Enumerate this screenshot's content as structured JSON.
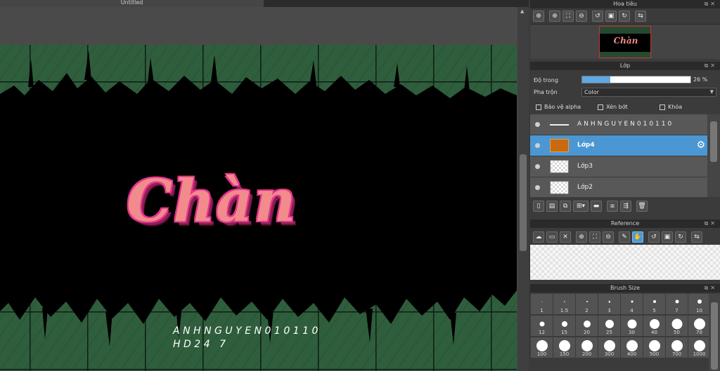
{
  "document": {
    "tab_title": "Untitled"
  },
  "artwork": {
    "title_text": "Chàn",
    "watermark_line1": "ANHNGUYEN010110",
    "watermark_line2": "HD24 7"
  },
  "navigator": {
    "title": "Hoa tiêu",
    "tools": [
      "zoom-in-icon",
      "zoom-in-icon",
      "fit-icon",
      "zoom-out-icon",
      "rotate-left-icon",
      "actual-size-icon",
      "rotate-right-icon",
      "flip-icon"
    ]
  },
  "layers": {
    "title": "Lớp",
    "opacity_label": "Độ trong",
    "opacity_value": "26 %",
    "opacity_fraction": 0.26,
    "blend_label": "Pha trộn",
    "blend_value": "Color",
    "protect_alpha_label": "Bảo vệ alpha",
    "clipping_label": "Xén bớt",
    "lock_label": "Khóa",
    "items": [
      {
        "name": "ANHNGUYEN010110",
        "thumb": "line",
        "selected": false
      },
      {
        "name": "Lớp4",
        "thumb": "orange",
        "selected": true
      },
      {
        "name": "Lớp3",
        "thumb": "transparent",
        "selected": false
      },
      {
        "name": "Lớp2",
        "thumb": "transparent",
        "selected": false
      }
    ]
  },
  "reference": {
    "title": "Reference"
  },
  "brush_size": {
    "title": "Brush Size",
    "sizes": [
      "1",
      "1.5",
      "2",
      "3",
      "4",
      "5",
      "7",
      "10",
      "12",
      "15",
      "20",
      "25",
      "30",
      "40",
      "50",
      "70",
      "100",
      "150",
      "200",
      "300",
      "400",
      "500",
      "700",
      "1000"
    ]
  },
  "colors": {
    "selection": "#4a97d4",
    "panel": "#3b3b3b",
    "header": "#2a2a2a",
    "canvas_green": "#2f5e3d",
    "title_pink": "#f28b8b",
    "title_outline": "#e3348e"
  }
}
